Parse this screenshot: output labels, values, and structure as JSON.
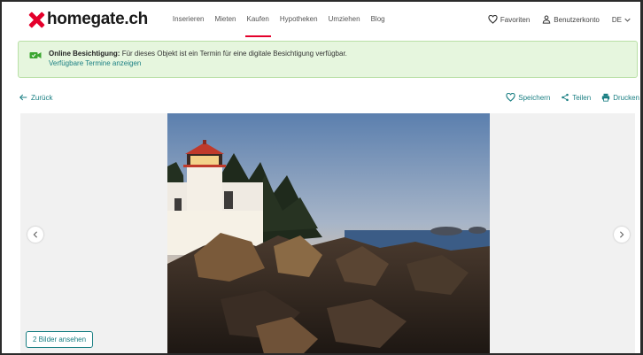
{
  "brand": {
    "logo_text": "homegate.ch",
    "accent": "#e4002b"
  },
  "nav": [
    {
      "label": "Inserieren",
      "active": false
    },
    {
      "label": "Mieten",
      "active": false
    },
    {
      "label": "Kaufen",
      "active": true
    },
    {
      "label": "Hypotheken",
      "active": false
    },
    {
      "label": "Umziehen",
      "active": false
    },
    {
      "label": "Blog",
      "active": false
    }
  ],
  "header_right": {
    "favorites": "Favoriten",
    "account": "Benutzerkonto",
    "language": "DE"
  },
  "banner": {
    "title": "Online Besichtigung:",
    "text": "Für dieses Objekt ist ein Termin für eine digitale Besichtigung verfügbar.",
    "link": "Verfügbare Termine anzeigen",
    "icon": "video-camera-icon"
  },
  "actions": {
    "back": "Zurück",
    "save": "Speichern",
    "share": "Teilen",
    "print": "Drucken"
  },
  "gallery": {
    "show_images": "2 Bilder ansehen"
  },
  "colors": {
    "teal": "#1a7f83",
    "banner_bg": "#e6f6de"
  }
}
